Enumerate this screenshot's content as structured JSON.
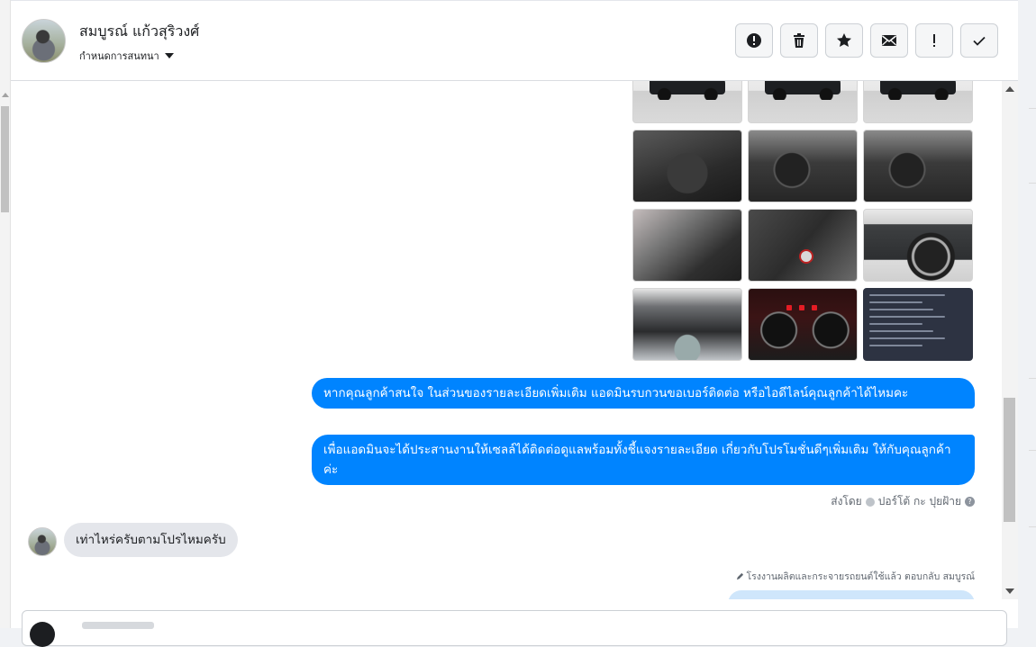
{
  "header": {
    "contact_name": "สมบูรณ์ แก้วสุริวงศ์",
    "assign_label": "กำหนดการสนทนา",
    "toolbar": [
      {
        "name": "spam-button",
        "icon": "alert-circle-icon"
      },
      {
        "name": "delete-button",
        "icon": "trash-icon"
      },
      {
        "name": "star-button",
        "icon": "star-icon"
      },
      {
        "name": "mark-unread-button",
        "icon": "envelope-icon"
      },
      {
        "name": "follow-up-button",
        "icon": "exclamation-icon"
      },
      {
        "name": "mark-done-button",
        "icon": "check-icon"
      }
    ]
  },
  "chat": {
    "photos": [
      {
        "kind": "exterior"
      },
      {
        "kind": "exterior"
      },
      {
        "kind": "exterior"
      },
      {
        "kind": "interior"
      },
      {
        "kind": "cabin"
      },
      {
        "kind": "cabin"
      },
      {
        "kind": "seat"
      },
      {
        "kind": "door"
      },
      {
        "kind": "side"
      },
      {
        "kind": "engine"
      },
      {
        "kind": "dash"
      },
      {
        "kind": "spec"
      }
    ],
    "outgoing": [
      "หากคุณลูกค้าสนใจ ในส่วนของรายละเอียดเพิ่มเติม แอดมินรบกวนขอเบอร์ติดต่อ หรือไอดีไลน์คุณลูกค้าได้ไหมคะ",
      "เพื่อแอดมินจะได้ประสานงานให้เซลล์ได้ติดต่อดูแลพร้อมทั้งชี้แจงรายละเอียด เกี่ยวกับโปรโมชั่นดีๆเพิ่มเติม ให้กับคุณลูกค้าค่ะ"
    ],
    "sent_by_label": "ส่งโดย",
    "sent_by_name": "ปอร์โต้ กะ ปุยฝ้าย",
    "incoming": "เท่าไหร่ครับตามโปรไหมครับ",
    "reply_note": "โรงงานผลิตและกระจายรถยนต์ใช้แล้ว ตอบกลับ สมบูรณ์"
  },
  "colors": {
    "outgoing_bubble": "#0084ff",
    "incoming_bubble": "#e4e6eb"
  }
}
